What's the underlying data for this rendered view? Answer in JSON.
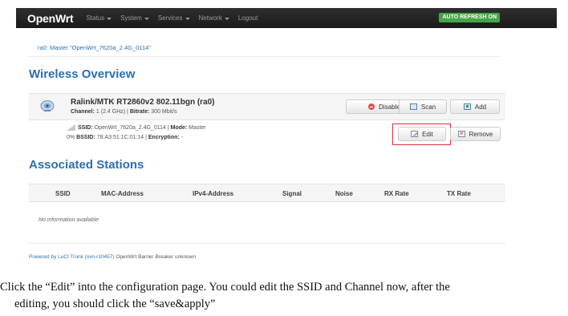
{
  "navbar": {
    "brand": "OpenWrt",
    "menu": [
      "Status",
      "System",
      "Services",
      "Network",
      "Logout"
    ],
    "auto_refresh": "AUTO REFRESH ON"
  },
  "wlan_link": "ra0: Master \"OpenWrt_7620a_2.4G_0114\"",
  "wireless": {
    "heading": "Wireless Overview",
    "radio": {
      "title": "Ralink/MTK RT2860v2 802.11bgn (ra0)",
      "channel_label": "Channel:",
      "channel_value": "1 (2.4 GHz)",
      "bitrate_label": "Bitrate:",
      "bitrate_value": "300 Mbit/s",
      "buttons": {
        "disable": "Disable",
        "scan": "Scan",
        "add": "Add"
      }
    },
    "network": {
      "ssid_label": "SSID:",
      "ssid_value": "OpenWrt_7620a_2.4G_0114",
      "mode_label": "Mode:",
      "mode_value": "Master",
      "signal_pct": "0%",
      "bssid_label": "BSSID:",
      "bssid_value": "78:A3:51:1C:01:14",
      "encryption_label": "Encryption:",
      "encryption_value": "-",
      "buttons": {
        "edit": "Edit",
        "remove": "Remove"
      }
    }
  },
  "stations": {
    "heading": "Associated Stations",
    "columns": [
      "SSID",
      "MAC-Address",
      "IPv4-Address",
      "Signal",
      "Noise",
      "RX Rate",
      "TX Rate"
    ],
    "empty_text": "No information available"
  },
  "footer": {
    "link": "Powered by LuCI Trunk (svn-r10457)",
    "text": "OpenWrt Barrier Breaker unknown"
  },
  "caption": {
    "line1": "Click the “Edit” into the configuration page. You could edit the SSID and Channel now, after the",
    "line2": "editing, you should click the “save&apply”"
  },
  "colors": {
    "navbar_bg": "#222222",
    "link_blue": "#2a6fb0",
    "auto_refresh_green": "#46a546",
    "highlight_red": "#d2313b"
  }
}
